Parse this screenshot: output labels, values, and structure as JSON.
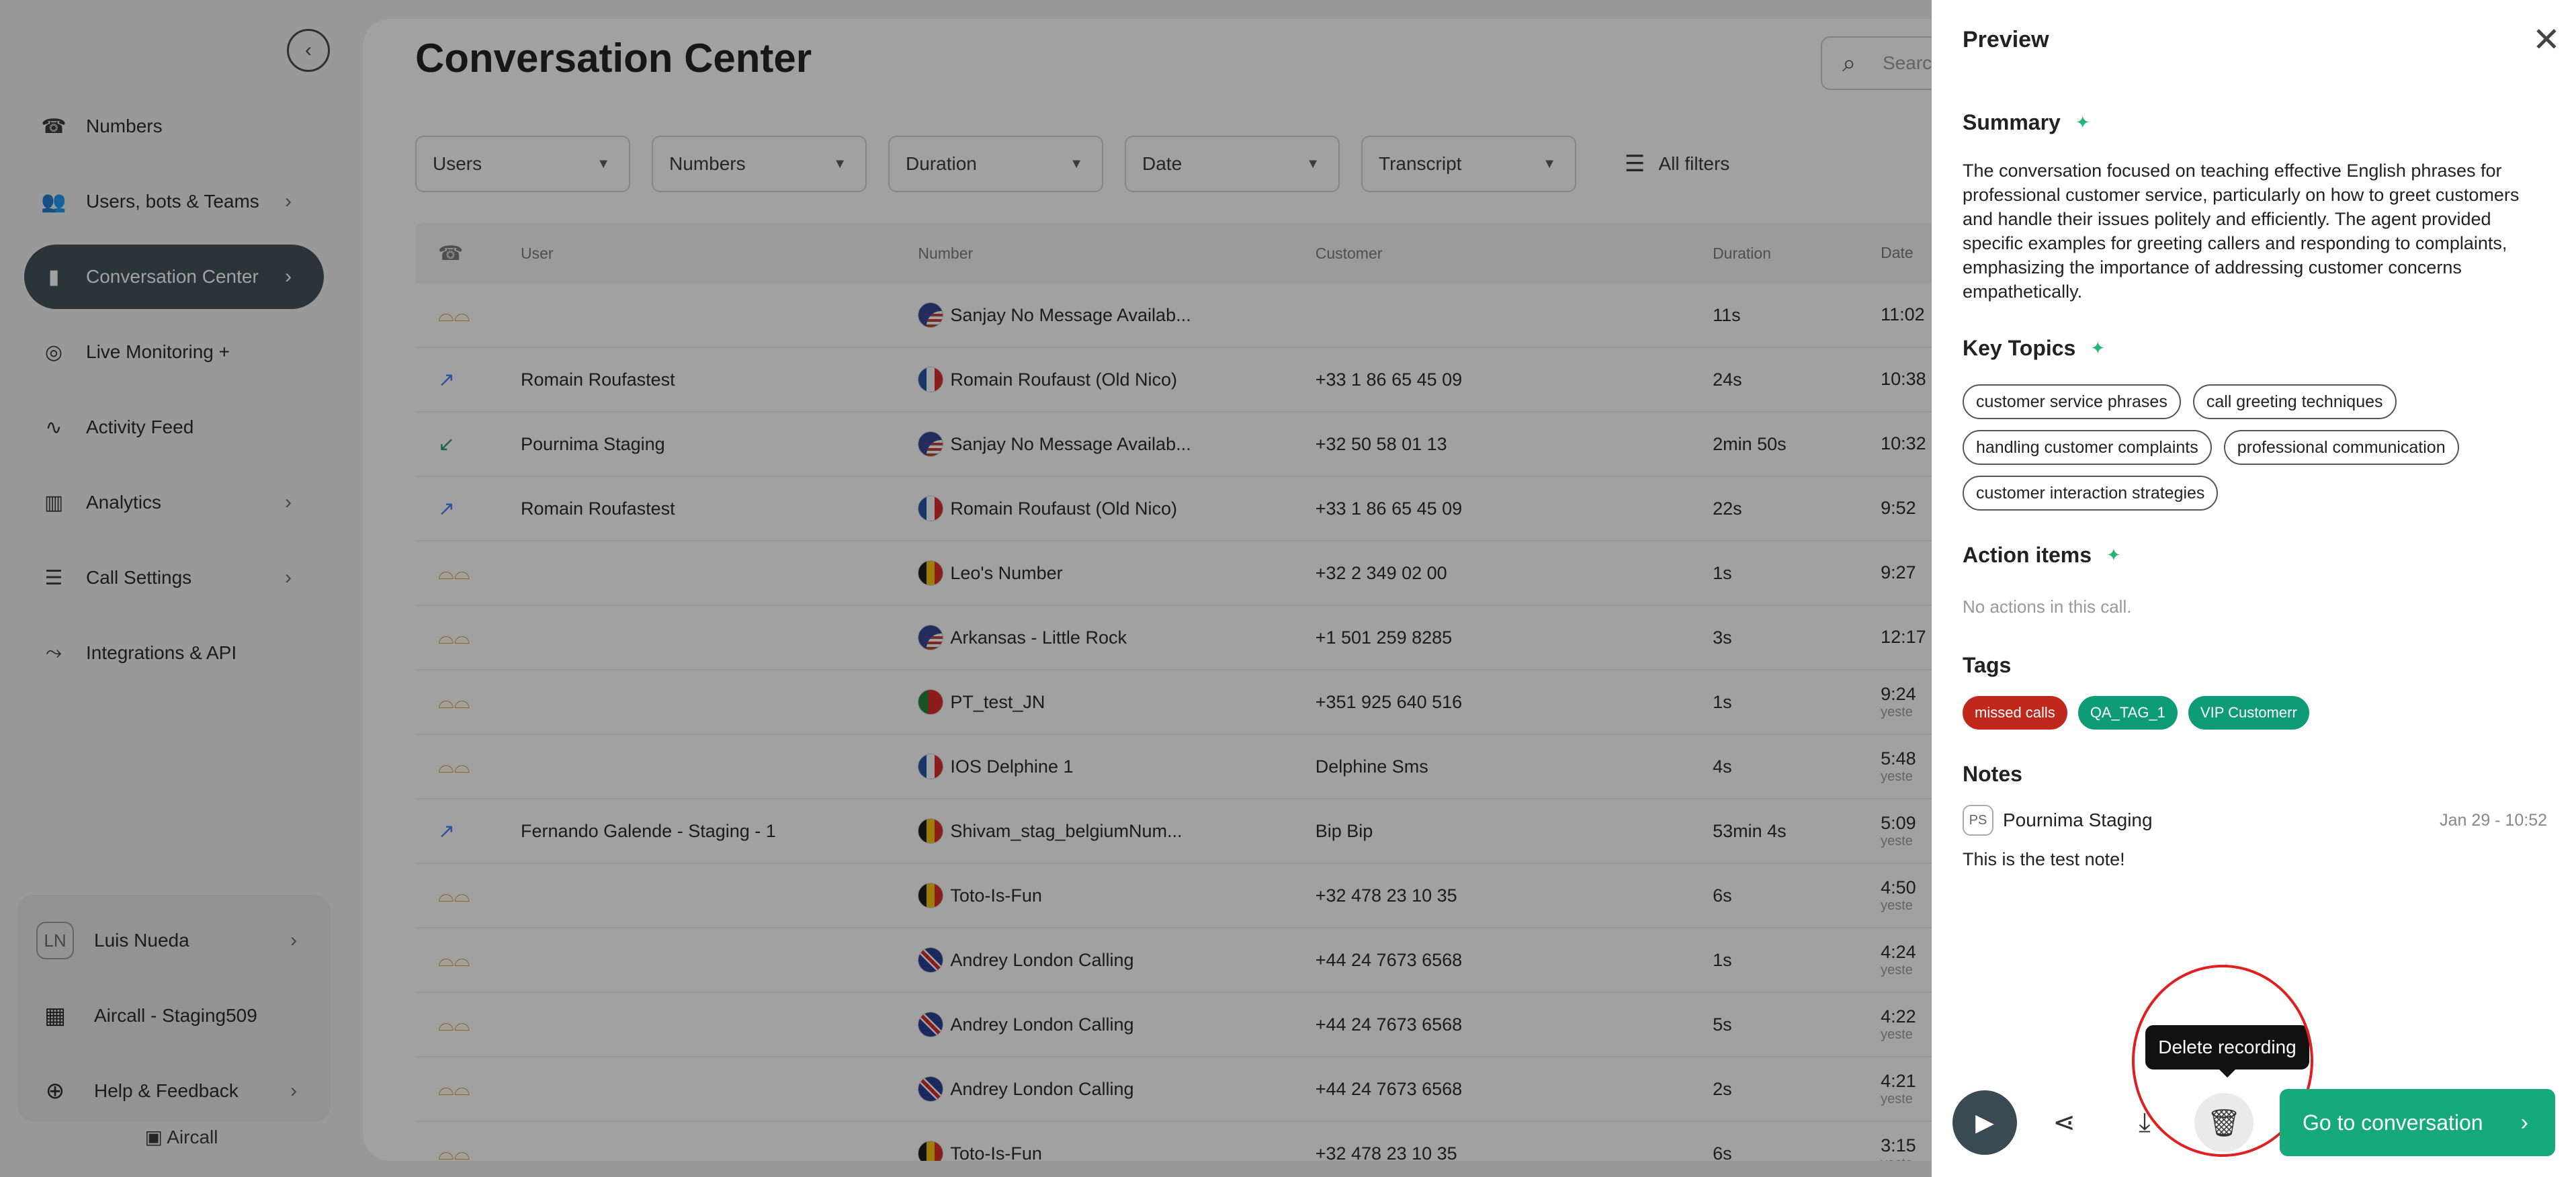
{
  "sidebar": {
    "items": [
      {
        "label": "Numbers",
        "icon": "☎",
        "chevron": false,
        "active": false
      },
      {
        "label": "Users, bots & Teams",
        "icon": "👥",
        "chevron": true,
        "active": false
      },
      {
        "label": "Conversation Center",
        "icon": "▮",
        "chevron": true,
        "active": true
      },
      {
        "label": "Live Monitoring +",
        "icon": "◎",
        "chevron": false,
        "active": false
      },
      {
        "label": "Activity Feed",
        "icon": "∿",
        "chevron": false,
        "active": false
      },
      {
        "label": "Analytics",
        "icon": "▥",
        "chevron": true,
        "active": false
      },
      {
        "label": "Call Settings",
        "icon": "☰",
        "chevron": true,
        "active": false
      },
      {
        "label": "Integrations & API",
        "icon": "⤳",
        "chevron": false,
        "active": false
      }
    ],
    "user_initials": "LN",
    "user_name": "Luis Nueda",
    "company": "Aircall - Staging509",
    "help": "Help & Feedback",
    "brand": "Aircall"
  },
  "main": {
    "title": "Conversation Center",
    "search_placeholder": "Search",
    "filters": [
      "Users",
      "Numbers",
      "Duration",
      "Date",
      "Transcript"
    ],
    "all_filters": "All filters",
    "columns": {
      "type": "☎",
      "user": "User",
      "number": "Number",
      "customer": "Customer",
      "duration": "Duration",
      "date": "Date"
    },
    "rows": [
      {
        "type": "vm",
        "user": "",
        "flag": "us",
        "number": "Sanjay No Message Availab...",
        "customer": "",
        "duration": "11s",
        "date": "11:02",
        "date_sub": ""
      },
      {
        "type": "out",
        "user": "Romain Roufastest",
        "flag": "fr",
        "number": "Romain Roufaust (Old Nico)",
        "customer": "+33 1 86 65 45 09",
        "duration": "24s",
        "date": "10:38",
        "date_sub": ""
      },
      {
        "type": "inc",
        "user": "Pournima Staging",
        "flag": "us",
        "number": "Sanjay No Message Availab...",
        "customer": "+32 50 58 01 13",
        "duration": "2min 50s",
        "date": "10:32",
        "date_sub": ""
      },
      {
        "type": "out",
        "user": "Romain Roufastest",
        "flag": "fr",
        "number": "Romain Roufaust (Old Nico)",
        "customer": "+33 1 86 65 45 09",
        "duration": "22s",
        "date": "9:52",
        "date_sub": ""
      },
      {
        "type": "vm",
        "user": "",
        "flag": "be",
        "number": "Leo's Number",
        "customer": "+32 2 349 02 00",
        "duration": "1s",
        "date": "9:27",
        "date_sub": ""
      },
      {
        "type": "vm",
        "user": "",
        "flag": "us",
        "number": "Arkansas - Little Rock",
        "customer": "+1 501 259 8285",
        "duration": "3s",
        "date": "12:17",
        "date_sub": ""
      },
      {
        "type": "vm",
        "user": "",
        "flag": "pt",
        "number": "PT_test_JN",
        "customer": "+351 925 640 516",
        "duration": "1s",
        "date": "9:24",
        "date_sub": "yeste"
      },
      {
        "type": "vm",
        "user": "",
        "flag": "fr",
        "number": "IOS Delphine 1",
        "customer": "Delphine Sms",
        "duration": "4s",
        "date": "5:48",
        "date_sub": "yeste"
      },
      {
        "type": "out",
        "user": "Fernando Galende - Staging - 1",
        "flag": "be",
        "number": "Shivam_stag_belgiumNum...",
        "customer": "Bip Bip",
        "duration": "53min 4s",
        "date": "5:09",
        "date_sub": "yeste"
      },
      {
        "type": "vm",
        "user": "",
        "flag": "be",
        "number": "Toto-Is-Fun",
        "customer": "+32 478 23 10 35",
        "duration": "6s",
        "date": "4:50",
        "date_sub": "yeste"
      },
      {
        "type": "vm",
        "user": "",
        "flag": "uk",
        "number": "Andrey London Calling",
        "customer": "+44 24 7673 6568",
        "duration": "1s",
        "date": "4:24",
        "date_sub": "yeste"
      },
      {
        "type": "vm",
        "user": "",
        "flag": "uk",
        "number": "Andrey London Calling",
        "customer": "+44 24 7673 6568",
        "duration": "5s",
        "date": "4:22",
        "date_sub": "yeste"
      },
      {
        "type": "vm",
        "user": "",
        "flag": "uk",
        "number": "Andrey London Calling",
        "customer": "+44 24 7673 6568",
        "duration": "2s",
        "date": "4:21",
        "date_sub": "yeste"
      },
      {
        "type": "vm",
        "user": "",
        "flag": "be",
        "number": "Toto-Is-Fun",
        "customer": "+32 478 23 10 35",
        "duration": "6s",
        "date": "3:15",
        "date_sub": "yeste"
      }
    ]
  },
  "preview": {
    "title": "Preview",
    "summary_heading": "Summary",
    "summary": "The conversation focused on teaching effective English phrases for professional customer service, particularly on how to greet customers and handle their issues politely and efficiently. The agent provided specific examples for greeting callers and responding to complaints, emphasizing the importance of addressing customer concerns empathetically.",
    "topics_heading": "Key Topics",
    "topics": [
      "customer service phrases",
      "call greeting techniques",
      "handling customer complaints",
      "professional communication",
      "customer interaction strategies"
    ],
    "actions_heading": "Action items",
    "no_actions": "No actions in this call.",
    "tags_heading": "Tags",
    "tags": [
      {
        "label": "missed calls",
        "color": "#c0281c"
      },
      {
        "label": "QA_TAG_1",
        "color": "#0e9c78"
      },
      {
        "label": "VIP Customerr",
        "color": "#0e9c78"
      }
    ],
    "notes_heading": "Notes",
    "note_initials": "PS",
    "note_author": "Pournima Staging",
    "note_date": "Jan 29 - 10:52",
    "note_text": "This is the test note!",
    "tooltip": "Delete recording",
    "goto_label": "Go to conversation"
  },
  "colors": {
    "accent": "#16a979",
    "active_nav": "#3a4a52",
    "voicemail": "#e0a020",
    "outgoing": "#3b82f6",
    "incoming": "#22a06b"
  }
}
